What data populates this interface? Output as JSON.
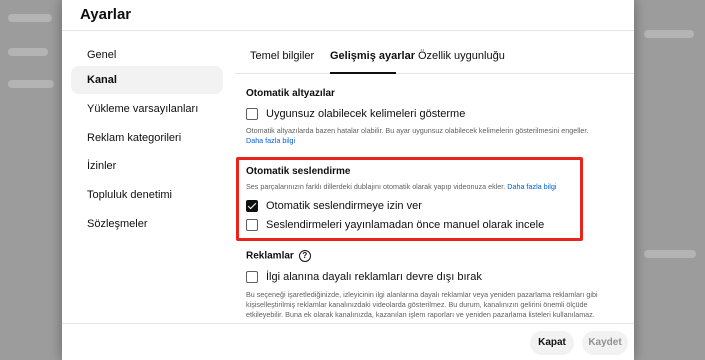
{
  "dialog": {
    "title": "Ayarlar"
  },
  "nav": {
    "items": [
      {
        "label": "Genel",
        "active": false
      },
      {
        "label": "Kanal",
        "active": true
      },
      {
        "label": "Yükleme varsayılanları",
        "active": false
      },
      {
        "label": "Reklam kategorileri",
        "active": false
      },
      {
        "label": "İzinler",
        "active": false
      },
      {
        "label": "Topluluk denetimi",
        "active": false
      },
      {
        "label": "Sözleşmeler",
        "active": false
      }
    ]
  },
  "tabs": [
    {
      "label": "Temel bilgiler",
      "active": false
    },
    {
      "label": "Gelişmiş ayarlar",
      "active": true
    },
    {
      "label": "Özellik uygunluğu",
      "active": false
    }
  ],
  "subtitles": {
    "title": "Otomatik altyazılar",
    "checkbox_label": "Uygunsuz olabilecek kelimeleri gösterme",
    "checked": false,
    "description": "Otomatik altyazılarda bazen hatalar olabilir. Bu ayar uygunsuz olabilecek kelimelerin gösterilmesini engeller.",
    "link": "Daha fazla bilgi"
  },
  "dubbing": {
    "title": "Otomatik seslendirme",
    "description": "Ses parçalarınızın farklı dillerdeki dublajını otomatik olarak yapıp videonuza ekler.",
    "link": "Daha fazla bilgi",
    "options": [
      {
        "label": "Otomatik seslendirmeye izin ver",
        "checked": true
      },
      {
        "label": "Seslendirmeleri yayınlamadan önce manuel olarak incele",
        "checked": false
      }
    ]
  },
  "ads": {
    "title": "Reklamlar",
    "checkbox_label": "İlgi alanına dayalı reklamları devre dışı bırak",
    "checked": false,
    "description_lines": [
      "Bu seçeneği işaretlediğinizde, izleyicinin ilgi alanlarına dayalı reklamlar veya yeniden pazarlama reklamları gibi",
      "kişiselleştirilmiş reklamlar kanalınızdaki videolarda gösterilmez. Bu durum, kanalınızın gelirini önemli ölçüde",
      "etkileyebilir. Buna ek olarak kanalınızda, kazanılan işlem raporları ve yeniden pazarlama listeleri kullanılamaz."
    ]
  },
  "footer": {
    "close_label": "Kapat",
    "save_label": "Kaydet"
  },
  "colors": {
    "highlight": "#e8251b",
    "link": "#065fd4"
  }
}
